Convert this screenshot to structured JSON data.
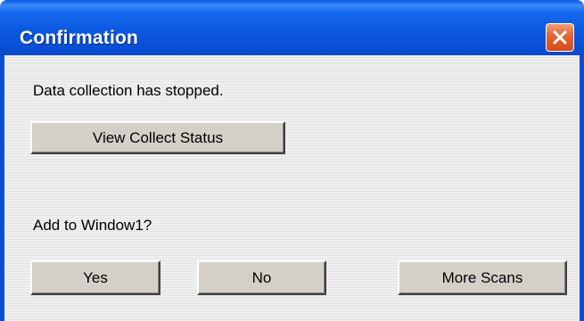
{
  "window": {
    "title": "Confirmation",
    "close_icon": "close-x-icon",
    "colors": {
      "titlebar": "#0a58e0",
      "close_button": "#e2683a",
      "client_background": "#ececec",
      "button_face": "#d4d0c8"
    }
  },
  "message": {
    "status_text": "Data collection has stopped.",
    "view_status_label": "View Collect Status",
    "question_text": "Add to Window1?"
  },
  "buttons": {
    "yes_label": "Yes",
    "no_label": "No",
    "more_scans_label": "More Scans"
  }
}
